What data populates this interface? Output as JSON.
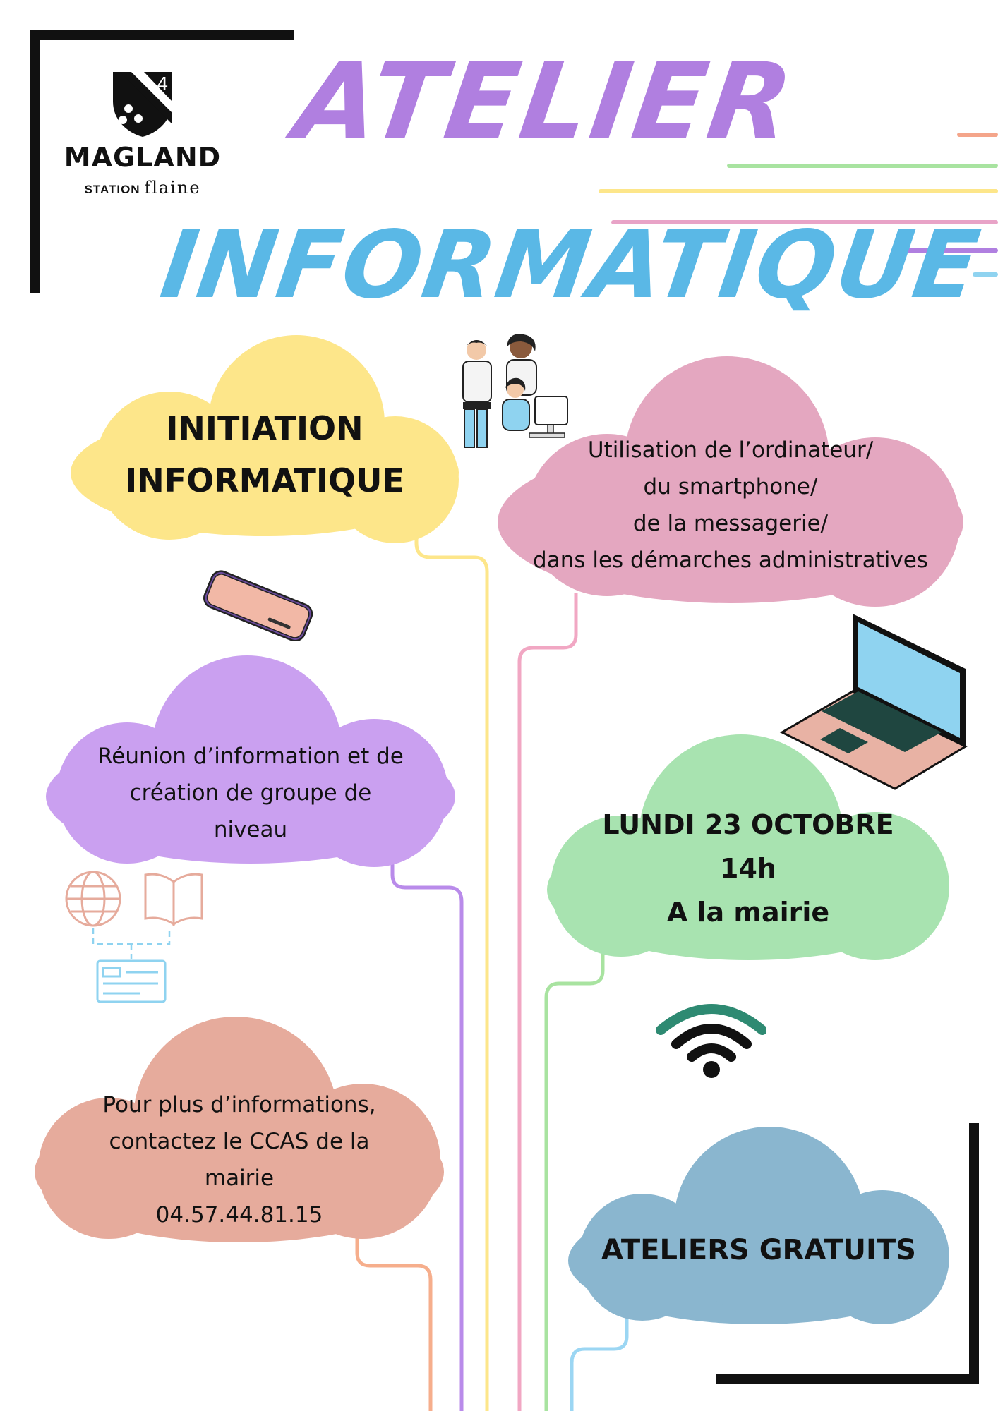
{
  "logo": {
    "name": "MAGLAND",
    "sub_station": "STATION",
    "sub_flaine": "flaine"
  },
  "title": {
    "line1": "ATELIER",
    "line2": "INFORMATIQUE"
  },
  "clouds": {
    "initiation": {
      "line1": "INITIATION",
      "line2": "INFORMATIQUE"
    },
    "usage": {
      "line1": "Utilisation de l’ordinateur/",
      "line2": "du smartphone/",
      "line3": "de la messagerie/",
      "line4": "dans les démarches administratives"
    },
    "reunion": {
      "line1": "Réunion d’information et de",
      "line2": "création de groupe de",
      "line3": "niveau"
    },
    "date": {
      "line1": "LUNDI 23 OCTOBRE",
      "line2": "14h",
      "line3": "A la mairie"
    },
    "contact": {
      "line1": "Pour plus d’informations,",
      "line2": "contactez le CCAS de la",
      "line3": "mairie",
      "line4": "04.57.44.81.15"
    },
    "gratuit": {
      "line1": "ATELIERS GRATUITS"
    }
  },
  "colors": {
    "purple_title": "#b07fe0",
    "blue_title": "#5ab8e6",
    "cloud_yellow": "#fde68a",
    "cloud_pink": "#e4a7c0",
    "cloud_purple": "#caa0f0",
    "cloud_green": "#a8e3b0",
    "cloud_salmon": "#e6ab9c",
    "cloud_blue": "#8ab6cf"
  },
  "icons": [
    "coat-of-arms-icon",
    "people-computer-icon",
    "smartphone-icon",
    "laptop-icon",
    "globe-icon",
    "book-icon",
    "id-card-icon",
    "wifi-icon"
  ]
}
